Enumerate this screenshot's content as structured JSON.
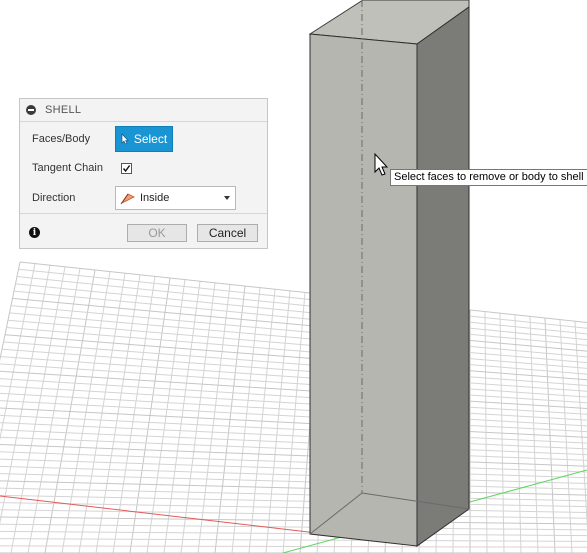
{
  "dialog": {
    "title": "SHELL",
    "rows": {
      "faces_body": {
        "label": "Faces/Body",
        "button_label": "Select"
      },
      "tangent_chain": {
        "label": "Tangent Chain",
        "checked": true
      },
      "direction": {
        "label": "Direction",
        "value": "Inside"
      }
    },
    "buttons": {
      "ok": "OK",
      "cancel": "Cancel"
    },
    "accent_color": "#1a95d3"
  },
  "tooltip": {
    "text": "Select faces to remove or body to shell"
  },
  "icons": {
    "collapse": "collapse-icon",
    "select_cursor": "cursor-arrow-icon",
    "direction": "shell-inside-icon",
    "info": "info-icon",
    "mouse_pointer": "mouse-pointer-icon"
  }
}
